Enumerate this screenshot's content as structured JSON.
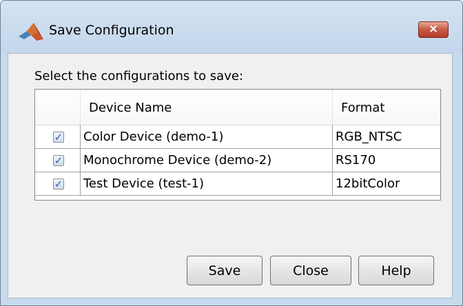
{
  "window": {
    "title": "Save Configuration",
    "close_glyph": "×"
  },
  "dialog": {
    "instruction": "Select the configurations to save:",
    "table": {
      "headers": [
        "",
        "Device Name",
        "Format"
      ],
      "rows": [
        {
          "checked": true,
          "check_glyph": "✓",
          "device": "Color Device (demo-1)",
          "format": "RGB_NTSC"
        },
        {
          "checked": true,
          "check_glyph": "✓",
          "device": "Monochrome Device (demo-2)",
          "format": "RS170"
        },
        {
          "checked": true,
          "check_glyph": "✓",
          "device": "Test Device (test-1)",
          "format": "12bitColor"
        }
      ]
    },
    "buttons": {
      "save": "Save",
      "close": "Close",
      "help": "Help"
    }
  },
  "icons": {
    "app": "matlab-membrane-icon",
    "close": "close-icon",
    "check": "checkmark-icon"
  },
  "colors": {
    "titlebar": "#c8daee",
    "client": "#f0f0f0",
    "close_button": "#c75a45"
  }
}
